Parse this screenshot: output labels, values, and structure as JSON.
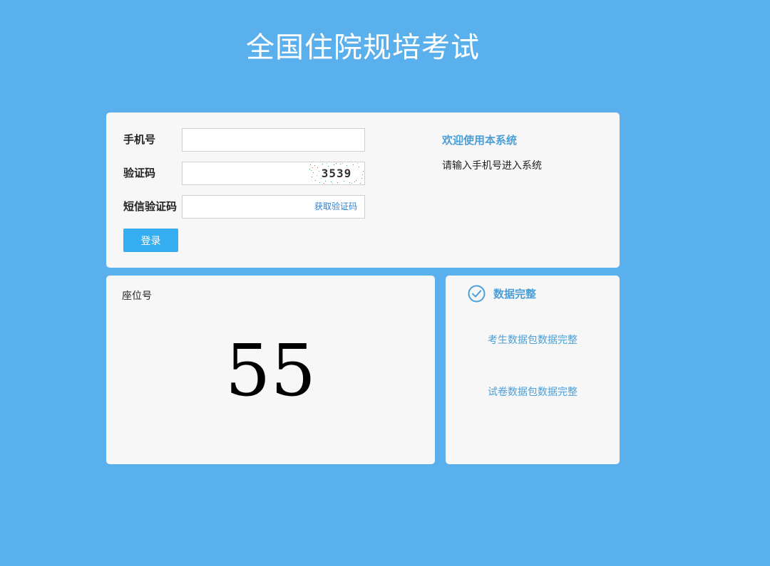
{
  "page": {
    "title": "全国住院规培考试"
  },
  "login": {
    "phone_label": "手机号",
    "phone_value": "",
    "captcha_label": "验证码",
    "captcha_value": "",
    "captcha_image_text": "3539",
    "sms_label": "短信验证码",
    "sms_value": "",
    "sms_link": "获取验证码",
    "submit_label": "登录"
  },
  "welcome": {
    "title": "欢迎使用本系统",
    "text": "请输入手机号进入系统"
  },
  "seat": {
    "label": "座位号",
    "number": "55"
  },
  "data_status": {
    "icon": "check-circle-icon",
    "title": "数据完整",
    "items": [
      "考生数据包数据完整",
      "试卷数据包数据完整"
    ]
  },
  "colors": {
    "background": "#5aafed",
    "panel": "#f7f7f7",
    "accent": "#4a9fd8",
    "button": "#35adf0",
    "link": "#2e7fd0"
  }
}
